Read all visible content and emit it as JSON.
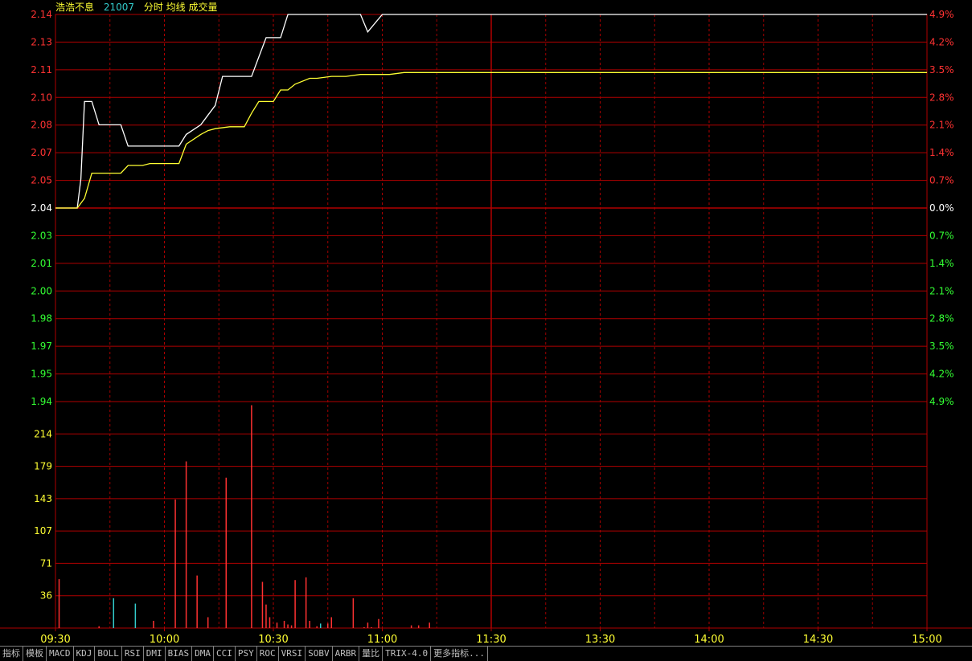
{
  "header": {
    "stock_name": "浩浩不息",
    "stock_code": "21007",
    "legend": "分时 均线 成交量"
  },
  "colors": {
    "price_line": "#ffffff",
    "avg_line": "#ffff33",
    "up": "#ff3232",
    "down": "#33ff33",
    "neutral": "#ffffff",
    "grid": "#b00000",
    "volume_up": "#ff3232",
    "volume_down": "#33cccc",
    "label_yellow": "#ffff33",
    "name_color": "#ffff33",
    "code_color": "#33cccc"
  },
  "tabs": [
    "指标",
    "模板",
    "MACD",
    "KDJ",
    "BOLL",
    "RSI",
    "DMI",
    "BIAS",
    "DMA",
    "CCI",
    "PSY",
    "ROC",
    "VRSI",
    "SOBV",
    "ARBR",
    "量比",
    "TRIX-4.0",
    "更多指标..."
  ],
  "chart_data": [
    {
      "type": "line",
      "x_axis_labels": [
        "09:30",
        "10:00",
        "10:30",
        "11:00",
        "11:30",
        "13:30",
        "14:00",
        "14:30",
        "15:00"
      ],
      "base_price": 2.04,
      "y_left_ticks_up": [
        "2.14",
        "2.13",
        "2.11",
        "2.10",
        "2.08",
        "2.07",
        "2.05"
      ],
      "y_left_base": "2.04",
      "y_left_ticks_down": [
        "2.03",
        "2.01",
        "2.00",
        "1.98",
        "1.97",
        "1.95",
        "1.94"
      ],
      "y_right_ticks_up": [
        "4.9%",
        "4.2%",
        "3.5%",
        "2.8%",
        "2.1%",
        "1.4%",
        "0.7%"
      ],
      "y_right_base": "0.0%",
      "y_right_ticks_down": [
        "0.7%",
        "1.4%",
        "2.1%",
        "2.8%",
        "3.5%",
        "4.2%",
        "4.9%"
      ],
      "ylim": [
        1.94,
        2.14
      ],
      "series": [
        {
          "key": "price",
          "x": [
            0,
            6,
            7,
            8,
            10,
            12,
            14,
            18,
            20,
            24,
            26,
            28,
            34,
            36,
            40,
            42,
            44,
            46,
            50,
            54,
            56,
            58,
            62,
            64,
            66,
            70,
            72,
            74,
            76,
            78,
            80,
            82,
            84,
            86,
            90,
            92,
            94,
            96,
            98,
            100,
            240
          ],
          "y": [
            2.04,
            2.04,
            2.055,
            2.095,
            2.095,
            2.083,
            2.083,
            2.083,
            2.072,
            2.072,
            2.072,
            2.072,
            2.072,
            2.078,
            2.083,
            2.088,
            2.093,
            2.108,
            2.108,
            2.108,
            2.118,
            2.128,
            2.128,
            2.14,
            2.14,
            2.14,
            2.14,
            2.14,
            2.14,
            2.14,
            2.14,
            2.14,
            2.14,
            2.131,
            2.14,
            2.14,
            2.14,
            2.14,
            2.14,
            2.14,
            2.14
          ]
        },
        {
          "key": "average",
          "x": [
            0,
            6,
            8,
            10,
            12,
            18,
            20,
            24,
            26,
            28,
            32,
            34,
            36,
            40,
            42,
            44,
            48,
            52,
            54,
            56,
            58,
            60,
            62,
            64,
            66,
            70,
            72,
            76,
            80,
            84,
            88,
            92,
            96,
            100,
            120,
            160,
            200,
            240
          ],
          "y": [
            2.04,
            2.04,
            2.045,
            2.058,
            2.058,
            2.058,
            2.062,
            2.062,
            2.063,
            2.063,
            2.063,
            2.063,
            2.073,
            2.078,
            2.08,
            2.081,
            2.082,
            2.082,
            2.089,
            2.095,
            2.095,
            2.095,
            2.101,
            2.101,
            2.104,
            2.107,
            2.107,
            2.108,
            2.108,
            2.109,
            2.109,
            2.109,
            2.11,
            2.11,
            2.11,
            2.11,
            2.11,
            2.11
          ]
        }
      ]
    },
    {
      "type": "bar",
      "y_ticks": [
        "214",
        "179",
        "143",
        "107",
        "71",
        "36"
      ],
      "ylim": [
        0,
        250
      ],
      "x": [
        1,
        12,
        16,
        22,
        27,
        33,
        36,
        39,
        42,
        47,
        54,
        57,
        58,
        59,
        61,
        63,
        64,
        65,
        66,
        69,
        70,
        72,
        73,
        75,
        76,
        82,
        85,
        86,
        87,
        89,
        98,
        100,
        103
      ],
      "values": [
        54,
        2,
        33,
        27,
        8,
        142,
        184,
        58,
        12,
        166,
        246,
        51,
        26,
        12,
        6,
        8,
        4,
        3,
        53,
        56,
        8,
        2,
        5,
        5,
        12,
        33,
        1,
        6,
        1,
        10,
        3,
        3,
        6
      ],
      "direction": [
        "up",
        "up",
        "down",
        "down",
        "up",
        "up",
        "up",
        "up",
        "up",
        "up",
        "up",
        "up",
        "up",
        "up",
        "up",
        "up",
        "up",
        "up",
        "up",
        "up",
        "up",
        "up",
        "down",
        "up",
        "up",
        "up",
        "up",
        "up",
        "up",
        "up",
        "up",
        "up",
        "up"
      ]
    }
  ]
}
